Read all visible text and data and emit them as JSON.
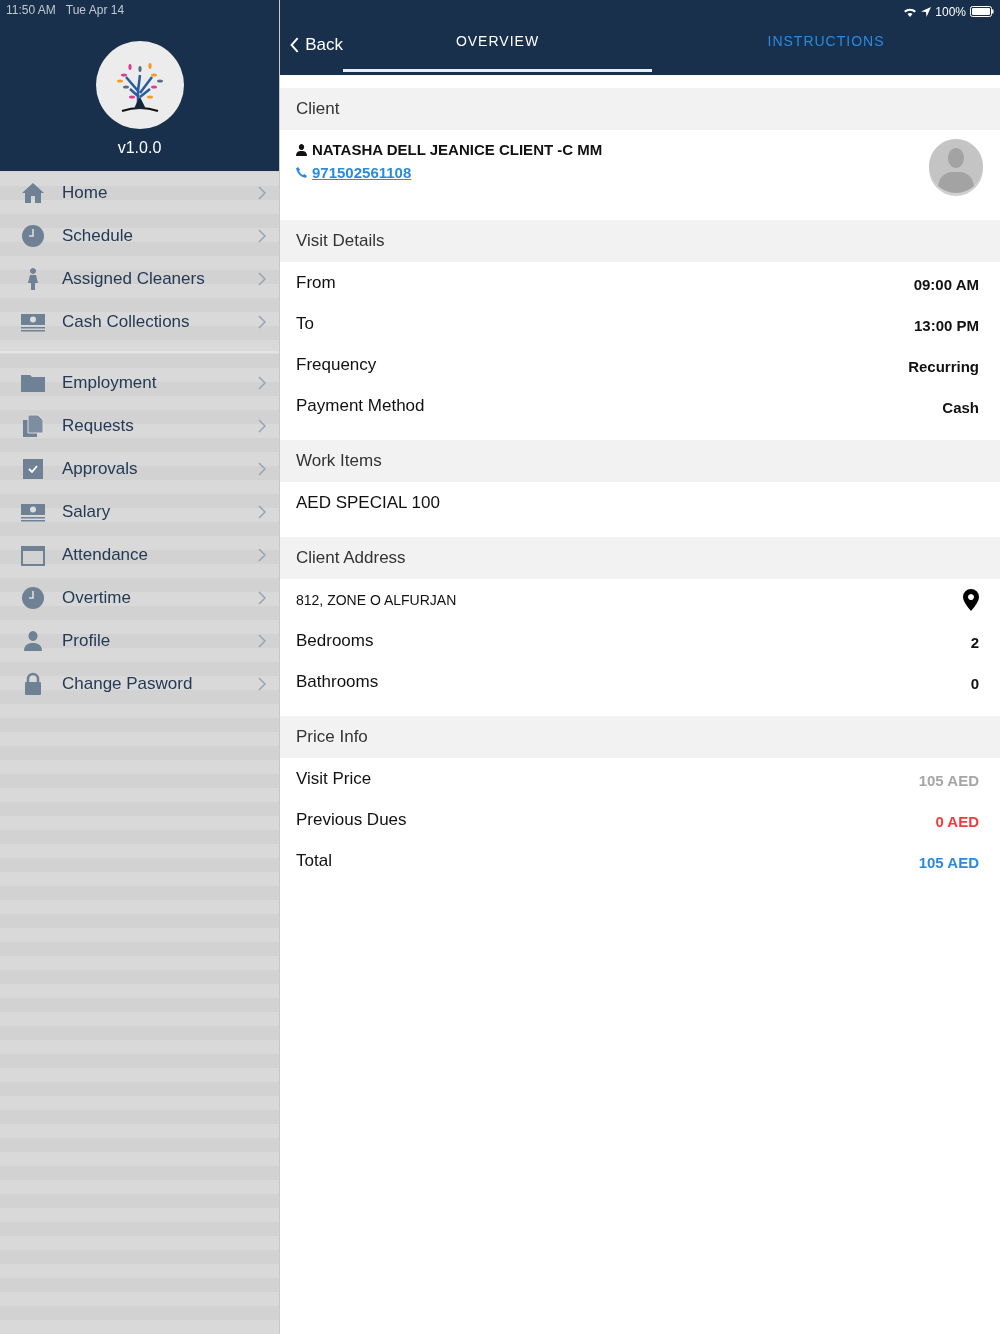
{
  "status_bar": {
    "time": "11:50 AM",
    "date": "Tue Apr 14",
    "battery": "100%"
  },
  "sidebar": {
    "version": "v1.0.0",
    "groups": [
      [
        {
          "label": "Home",
          "kind": "home"
        },
        {
          "label": "Schedule",
          "kind": "clock"
        },
        {
          "label": "Assigned Cleaners",
          "kind": "person"
        },
        {
          "label": "Cash Collections",
          "kind": "cash"
        }
      ],
      [
        {
          "label": "Employment",
          "kind": "folder"
        },
        {
          "label": "Requests",
          "kind": "pages"
        },
        {
          "label": "Approvals",
          "kind": "check"
        },
        {
          "label": "Salary",
          "kind": "cash"
        },
        {
          "label": "Attendance",
          "kind": "calendar"
        },
        {
          "label": "Overtime",
          "kind": "clock"
        },
        {
          "label": "Profile",
          "kind": "profile"
        },
        {
          "label": "Change Pasword",
          "kind": "lock"
        }
      ]
    ]
  },
  "header": {
    "back": "Back",
    "tabs": [
      {
        "label": "OVERVIEW",
        "selected": true
      },
      {
        "label": "INSTRUCTIONS",
        "selected": false
      }
    ]
  },
  "sections": [
    {
      "title": "Client",
      "rows": [
        {
          "kind": "client",
          "name": "NATASHA DELL JEANICE CLIENT -C MM",
          "phone": "971502561108"
        }
      ]
    },
    {
      "title": "Visit Details",
      "rows": [
        {
          "kind": "pair",
          "label": "From",
          "value": "09:00 AM"
        },
        {
          "kind": "pair",
          "label": "To",
          "value": "13:00 PM"
        },
        {
          "kind": "pair",
          "label": "Frequency",
          "value": "Recurring"
        },
        {
          "kind": "pair",
          "label": "Payment Method",
          "value": "Cash"
        }
      ]
    },
    {
      "title": "Work Items",
      "rows": [
        {
          "kind": "text",
          "label": "AED SPECIAL 100"
        }
      ]
    },
    {
      "title": "Client Address",
      "rows": [
        {
          "kind": "address",
          "label": "812, ZONE O ALFURJAN"
        },
        {
          "kind": "pair",
          "label": "Bedrooms",
          "value": "2"
        },
        {
          "kind": "pair",
          "label": "Bathrooms",
          "value": "0"
        }
      ]
    },
    {
      "title": "Price Info",
      "rows": [
        {
          "kind": "pair",
          "label": "Visit Price",
          "value": "105 AED",
          "color": "#a6a6a6"
        },
        {
          "kind": "pair",
          "label": "Previous Dues",
          "value": "0 AED",
          "color": "#f03c3c"
        },
        {
          "kind": "pair",
          "label": "Total",
          "value": "105 AED",
          "color": "#2a8ae0"
        }
      ]
    }
  ]
}
